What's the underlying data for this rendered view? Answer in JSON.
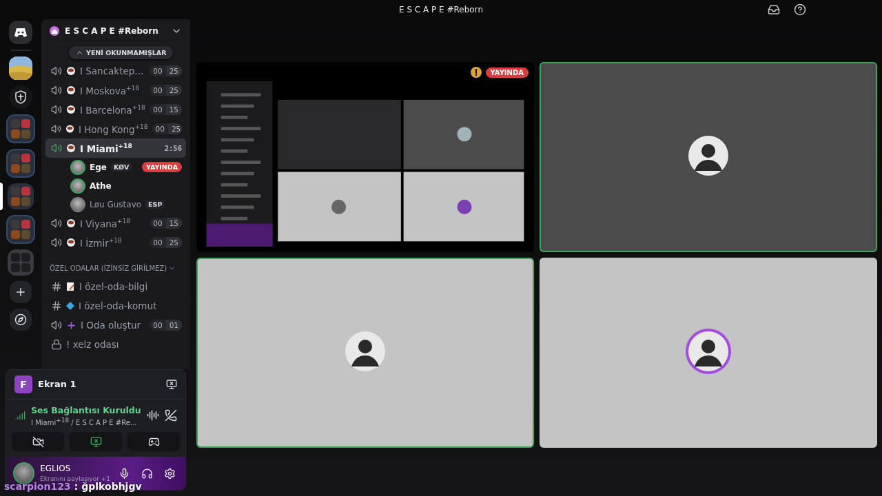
{
  "window": {
    "title": "E S C A P E #Reborn"
  },
  "servers": [
    {
      "kind": "home",
      "selected": false
    },
    {
      "kind": "picture",
      "selected": false
    },
    {
      "kind": "server",
      "selected": false
    },
    {
      "kind": "folder",
      "selected": false
    },
    {
      "kind": "folder",
      "selected": false
    },
    {
      "kind": "folder",
      "selected": true
    },
    {
      "kind": "folder",
      "selected": false
    },
    {
      "kind": "empty-folder",
      "selected": false
    },
    {
      "kind": "add",
      "selected": false
    },
    {
      "kind": "discover",
      "selected": false
    }
  ],
  "guild": {
    "name": "E S C A P E #Reborn",
    "unread_pill": "YENİ OKUNMAMIŞLAR"
  },
  "channels": [
    {
      "kind": "voice",
      "name": "I Sancaktep...",
      "selected": false,
      "counts": [
        "00",
        "25"
      ]
    },
    {
      "kind": "voice",
      "name": "I Moskova$^{+18}$",
      "selected": false,
      "counts": [
        "00",
        "25"
      ]
    },
    {
      "kind": "voice",
      "name": "I Barcelona$^{+18}$",
      "selected": false,
      "counts": [
        "00",
        "15"
      ]
    },
    {
      "kind": "voice",
      "name": "I Hong Kong$^{+18}$",
      "selected": false,
      "counts": [
        "00",
        "25"
      ]
    },
    {
      "kind": "voice",
      "name": "I Miami$^{+18}$",
      "selected": true,
      "time": "2:56",
      "members": [
        {
          "name": "Ege",
          "tag": "KØV",
          "live": "YAYINDA",
          "speaking": true
        },
        {
          "name": "Athe",
          "speaking": true
        },
        {
          "name": "Løu Gustavo",
          "tag": "ESP",
          "speaking": false
        }
      ]
    },
    {
      "kind": "voice",
      "name": "I Viyana$^{+18}$",
      "selected": false,
      "counts": [
        "00",
        "15"
      ]
    },
    {
      "kind": "voice",
      "name": "I İzmir$^{+18}$",
      "selected": false,
      "counts": [
        "00",
        "25"
      ]
    }
  ],
  "category": {
    "name": "ÖZEL ODALAR (İZİNSİZ GİRİLMEZ)",
    "expanded": true,
    "channels": [
      {
        "kind": "text",
        "name": "I özel-oda-bilgi",
        "selected": false
      },
      {
        "kind": "text",
        "name": "I özel-oda-komut",
        "selected": false
      },
      {
        "kind": "voice",
        "name": "I Oda oluştur",
        "selected": false,
        "counts": [
          "00",
          "01"
        ]
      },
      {
        "kind": "locked",
        "name": "! xelz odası",
        "selected": false
      }
    ]
  },
  "panel": {
    "stream": {
      "title": "Ekran 1",
      "avatar_letter": "F"
    },
    "voice": {
      "status": "Ses Bağlantısı Kuruldu",
      "location": "I Miami$^{+18}$ / E S C A P E #Re..."
    },
    "user": {
      "name": "EGLIOS",
      "status": "Ekranını paylaşıyor +1"
    }
  },
  "chat": {
    "user": "scarpion123",
    "separator": ":",
    "message": "ğplkobhjgv"
  },
  "tiles": [
    {
      "kind": "screen",
      "speaking": false,
      "badge": "YAYINDA"
    },
    {
      "kind": "dark",
      "speaking": true,
      "glow": false
    },
    {
      "kind": "light",
      "speaking": true,
      "glow": false
    },
    {
      "kind": "light",
      "speaking": false,
      "glow": true
    }
  ]
}
